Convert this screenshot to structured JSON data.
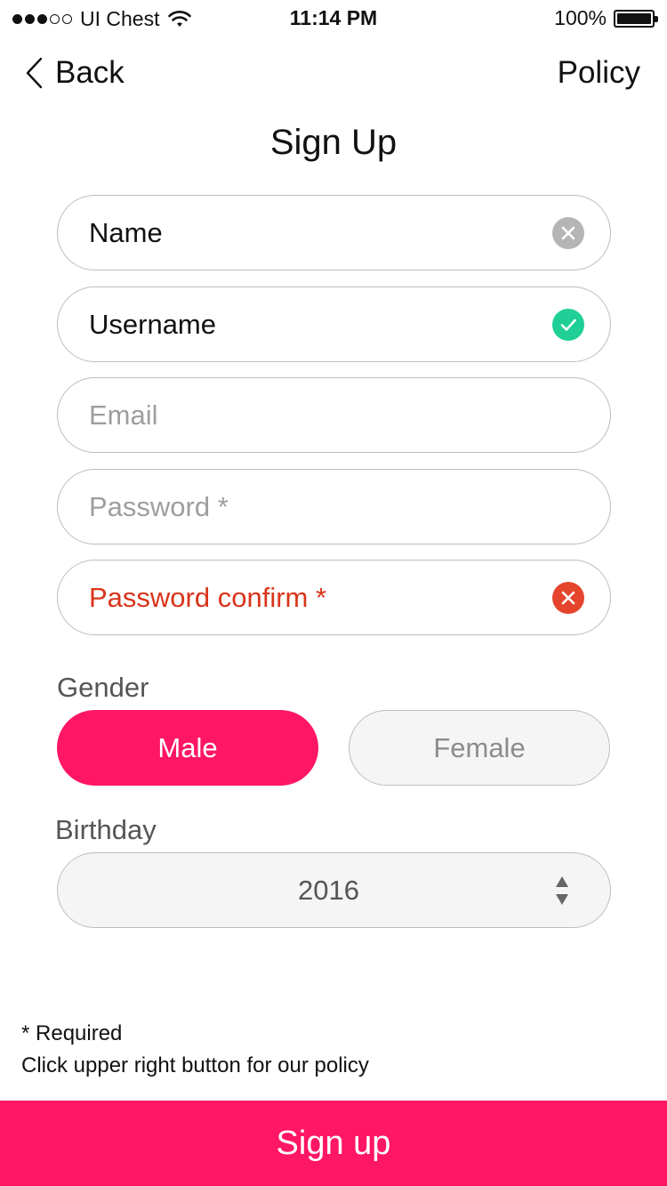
{
  "status_bar": {
    "carrier": "UI Chest",
    "time": "11:14 PM",
    "battery": "100%",
    "signal_strength": 3,
    "signal_total": 5
  },
  "nav": {
    "back_label": "Back",
    "policy_label": "Policy"
  },
  "title": "Sign Up",
  "fields": {
    "name": {
      "value": "Name",
      "state": "clearable",
      "icon": "clear-icon"
    },
    "username": {
      "value": "Username",
      "state": "valid",
      "icon": "check-icon"
    },
    "email": {
      "placeholder": "Email"
    },
    "password": {
      "placeholder": "Password *"
    },
    "password_confirm": {
      "value": "Password confirm *",
      "state": "error",
      "icon": "error-icon"
    }
  },
  "gender": {
    "label": "Gender",
    "options": [
      "Male",
      "Female"
    ],
    "selected": "Male"
  },
  "birthday": {
    "label": "Birthday",
    "value": "2016"
  },
  "footnotes": {
    "required": "* Required",
    "policy_hint": "Click upper right button for our policy"
  },
  "submit_label": "Sign up",
  "colors": {
    "accent": "#ff1665",
    "valid": "#1fcf96",
    "error": "#e5452c",
    "clear": "#b5b5b5"
  }
}
